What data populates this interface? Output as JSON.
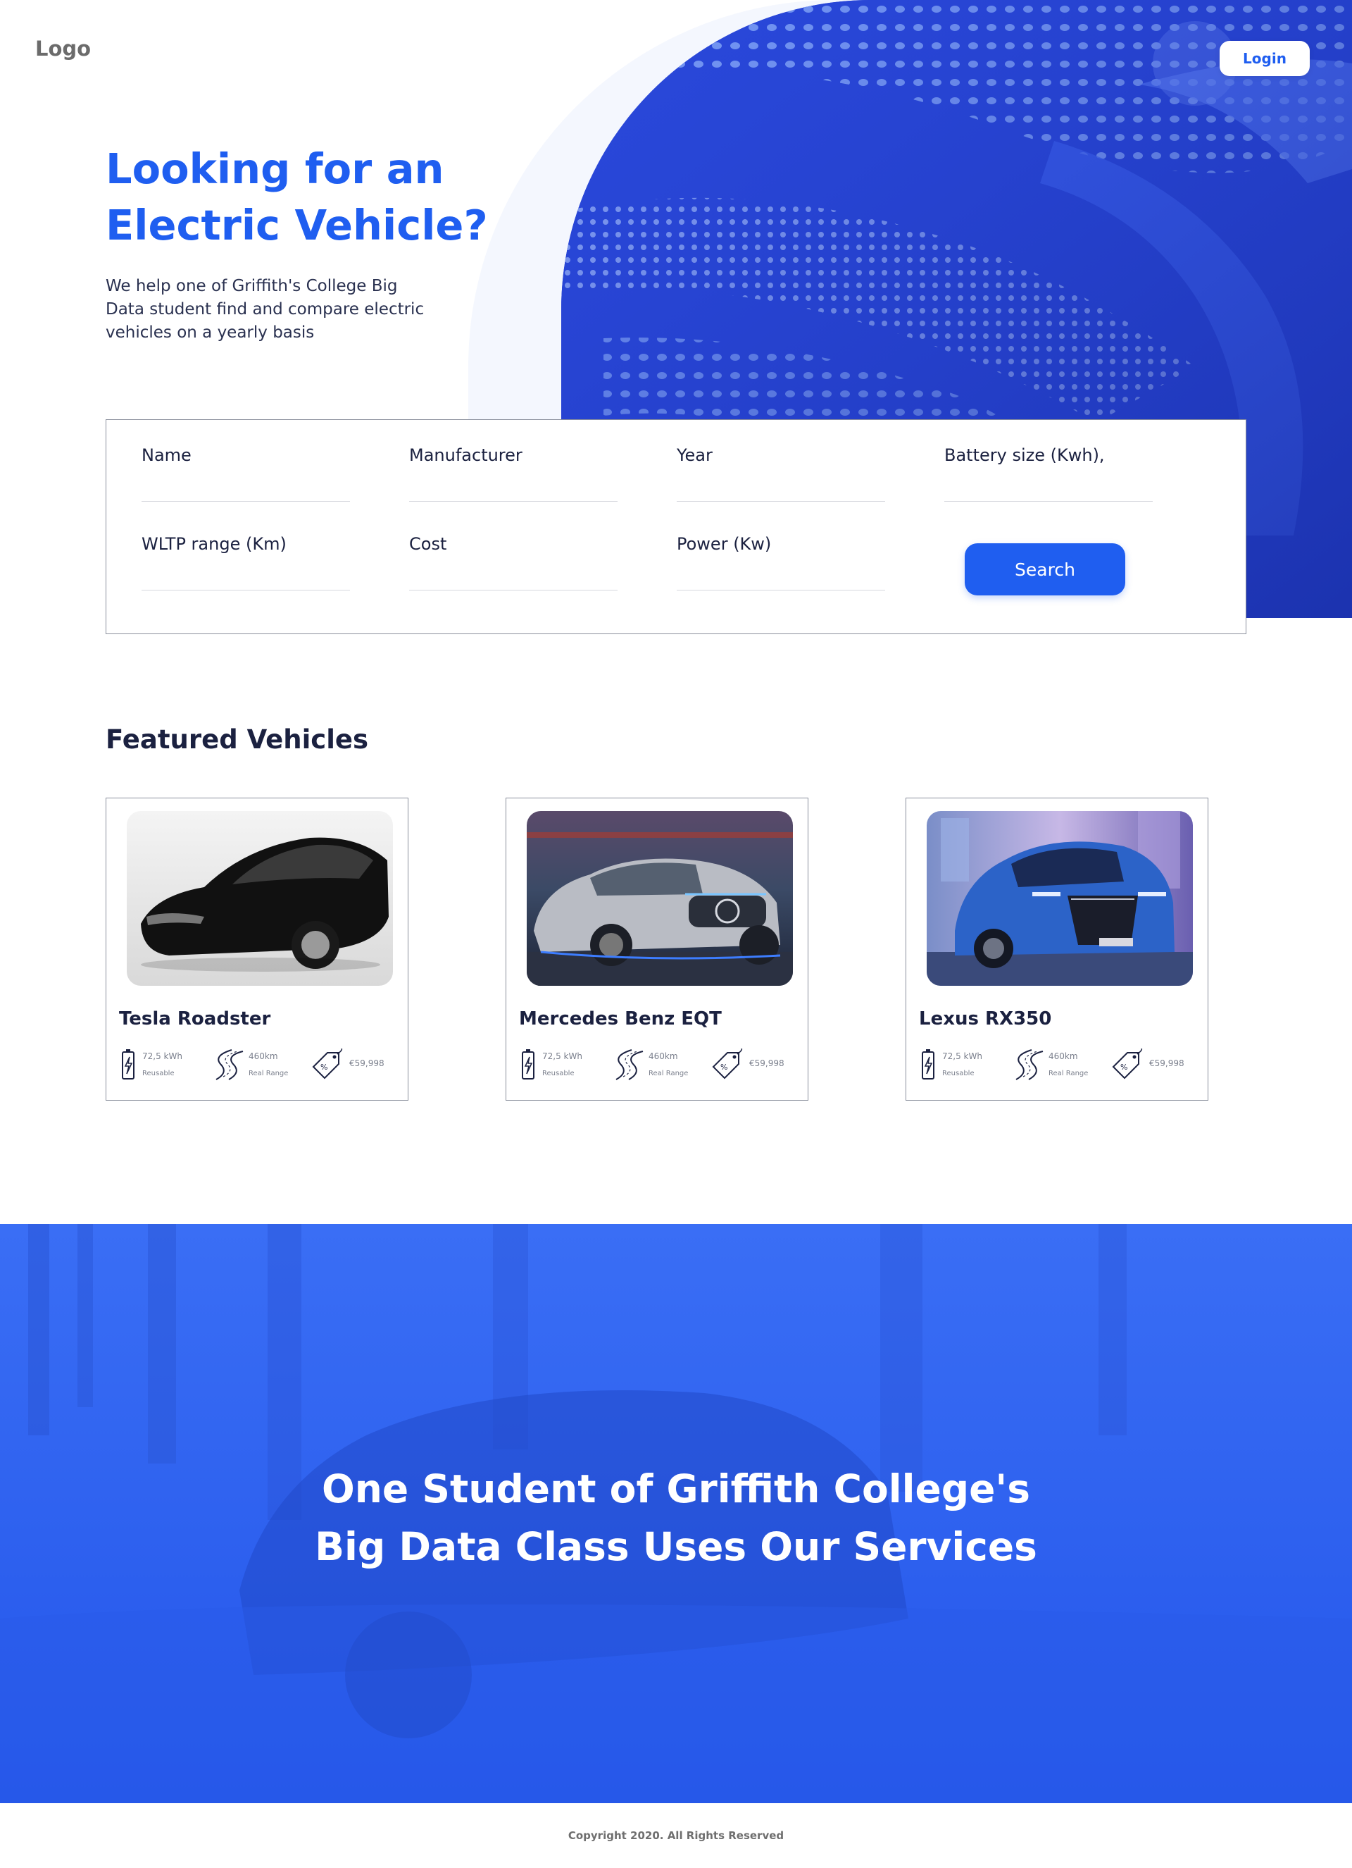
{
  "header": {
    "logo": "Logo",
    "login_label": "Login"
  },
  "hero": {
    "title": "Looking for an Electric Vehicle?",
    "subtitle": "We help one of Griffith's College Big Data student find and compare electric vehicles on a yearly basis"
  },
  "search": {
    "fields": [
      {
        "label": "Name",
        "value": ""
      },
      {
        "label": "Manufacturer",
        "value": ""
      },
      {
        "label": "Year",
        "value": ""
      },
      {
        "label": "Battery size (Kwh),",
        "value": ""
      },
      {
        "label": "WLTP range (Km)",
        "value": ""
      },
      {
        "label": "Cost",
        "value": ""
      },
      {
        "label": "Power (Kw)",
        "value": ""
      }
    ],
    "button_label": "Search"
  },
  "featured": {
    "title": "Featured Vehicles",
    "cards": [
      {
        "name": "Tesla Roadster",
        "battery": "72,5 kWh",
        "battery_label": "Reusable",
        "range": "460km",
        "range_label": "Real Range",
        "price": "€59,998"
      },
      {
        "name": "Mercedes Benz EQT",
        "battery": "72,5 kWh",
        "battery_label": "Reusable",
        "range": "460km",
        "range_label": "Real Range",
        "price": "€59,998"
      },
      {
        "name": "Lexus RX350",
        "battery": "72,5 kWh",
        "battery_label": "Reusable",
        "range": "460km",
        "range_label": "Real Range",
        "price": "€59,998"
      }
    ]
  },
  "banner": {
    "title": "One Student of Griffith College's\n Big Data Class Uses Our Services"
  },
  "footer": {
    "copyright": "Copyright 2020. All Rights Reserved"
  },
  "colors": {
    "primary": "#1f5ef0",
    "dark_text": "#1b2140",
    "banner": "#2d63f2"
  }
}
